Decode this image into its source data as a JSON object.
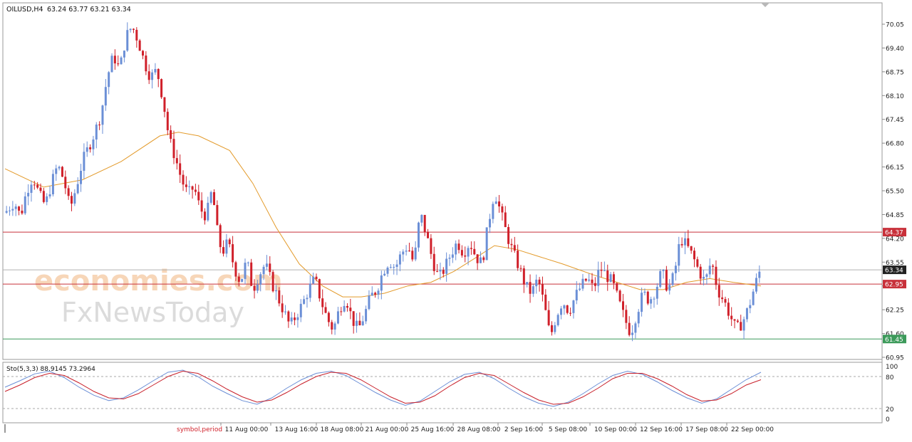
{
  "header": {
    "symbol": "OILUSD,H4",
    "ohlc": "63.24 63.77 63.21 63.34"
  },
  "watermark": {
    "line1": "economies.com",
    "line2": "FxNewsToday"
  },
  "price_axis": {
    "ticks": [
      "70.05",
      "69.40",
      "68.75",
      "68.10",
      "67.45",
      "66.80",
      "66.15",
      "65.50",
      "64.85",
      "64.20",
      "63.55",
      "62.90",
      "62.25",
      "61.60",
      "60.95"
    ]
  },
  "oscillator": {
    "label": "Sto(5,3,3) 88.9145 73.2964",
    "ticks": [
      "100",
      "80",
      "20",
      "0"
    ]
  },
  "time_axis": {
    "ticks": [
      "11 Aug 00:00",
      "13 Aug 16:00",
      "18 Aug 08:00",
      "21 Aug 00:00",
      "25 Aug 16:00",
      "28 Aug 08:00",
      "2 Sep 16:00",
      "5 Sep 08:00",
      "10 Sep 00:00",
      "12 Sep 16:00",
      "17 Sep 08:00",
      "22 Sep 00:00"
    ],
    "note": "symbol,period"
  },
  "colors": {
    "bull": "#6b8fd6",
    "bear": "#d0202a",
    "ma": "#e39a2a",
    "sto_main": "#6b8fd6",
    "sto_signal": "#c8202a",
    "red_line": "#c8303a",
    "green_line": "#3c9a5a",
    "current_line": "#b0b0b0"
  },
  "chart_data": {
    "type": "candlestick",
    "title": "OILUSD,H4",
    "ylim": [
      60.65,
      70.5
    ],
    "levels": [
      {
        "label": "64.37",
        "value": 64.37,
        "color": "#c8303a"
      },
      {
        "label": "63.34",
        "value": 63.34,
        "color": "#222222",
        "current": true
      },
      {
        "label": "62.95",
        "value": 62.95,
        "color": "#c8303a"
      },
      {
        "label": "61.45",
        "value": 61.45,
        "color": "#3c9a5a"
      }
    ],
    "close_path": [
      [
        0,
        64.9
      ],
      [
        6,
        65.2
      ],
      [
        10,
        64.8
      ],
      [
        14,
        65.5
      ],
      [
        18,
        65.9
      ],
      [
        22,
        65.4
      ],
      [
        26,
        65.1
      ],
      [
        30,
        65.7
      ],
      [
        34,
        66.2
      ],
      [
        38,
        65.8
      ],
      [
        42,
        65.0
      ],
      [
        46,
        65.6
      ],
      [
        50,
        66.3
      ],
      [
        54,
        66.7
      ],
      [
        58,
        67.1
      ],
      [
        62,
        67.6
      ],
      [
        66,
        68.6
      ],
      [
        70,
        69.2
      ],
      [
        74,
        68.8
      ],
      [
        78,
        69.7
      ],
      [
        82,
        70.0
      ],
      [
        86,
        69.6
      ],
      [
        90,
        69.0
      ],
      [
        94,
        68.6
      ],
      [
        98,
        68.8
      ],
      [
        102,
        68.0
      ],
      [
        106,
        66.9
      ],
      [
        110,
        66.4
      ],
      [
        114,
        65.8
      ],
      [
        118,
        65.4
      ],
      [
        122,
        65.6
      ],
      [
        126,
        65.0
      ],
      [
        130,
        64.8
      ],
      [
        134,
        65.6
      ],
      [
        136,
        64.6
      ],
      [
        140,
        63.8
      ],
      [
        144,
        64.1
      ],
      [
        148,
        63.4
      ],
      [
        152,
        63.0
      ],
      [
        156,
        63.6
      ],
      [
        160,
        62.8
      ],
      [
        164,
        63.2
      ],
      [
        168,
        63.5
      ],
      [
        172,
        63.0
      ],
      [
        176,
        62.6
      ],
      [
        180,
        62.2
      ],
      [
        184,
        61.8
      ],
      [
        188,
        62.1
      ],
      [
        192,
        62.4
      ],
      [
        196,
        62.8
      ],
      [
        200,
        63.1
      ],
      [
        204,
        62.5
      ],
      [
        208,
        62.0
      ],
      [
        212,
        61.7
      ],
      [
        216,
        62.3
      ],
      [
        220,
        62.6
      ],
      [
        224,
        62.0
      ],
      [
        228,
        61.7
      ],
      [
        232,
        62.1
      ],
      [
        236,
        62.6
      ],
      [
        240,
        62.8
      ],
      [
        244,
        63.3
      ],
      [
        248,
        63.6
      ],
      [
        252,
        63.4
      ],
      [
        256,
        63.8
      ],
      [
        260,
        64.0
      ],
      [
        264,
        63.5
      ],
      [
        268,
        64.9
      ],
      [
        272,
        64.3
      ],
      [
        276,
        63.6
      ],
      [
        280,
        63.1
      ],
      [
        284,
        63.4
      ],
      [
        288,
        63.8
      ],
      [
        292,
        64.1
      ],
      [
        296,
        63.8
      ],
      [
        300,
        64.1
      ],
      [
        304,
        63.7
      ],
      [
        308,
        63.5
      ],
      [
        312,
        64.6
      ],
      [
        316,
        65.5
      ],
      [
        320,
        64.9
      ],
      [
        324,
        64.3
      ],
      [
        328,
        63.8
      ],
      [
        332,
        63.4
      ],
      [
        336,
        62.9
      ],
      [
        340,
        62.7
      ],
      [
        344,
        63.1
      ],
      [
        348,
        62.4
      ],
      [
        352,
        61.5
      ],
      [
        356,
        62.1
      ],
      [
        360,
        62.5
      ],
      [
        364,
        62.2
      ],
      [
        368,
        62.6
      ],
      [
        372,
        62.9
      ],
      [
        376,
        63.1
      ],
      [
        380,
        62.8
      ],
      [
        384,
        63.4
      ],
      [
        388,
        63.2
      ],
      [
        392,
        63.0
      ],
      [
        396,
        62.5
      ],
      [
        400,
        62.0
      ],
      [
        404,
        61.6
      ],
      [
        408,
        62.2
      ],
      [
        412,
        62.7
      ],
      [
        416,
        62.5
      ],
      [
        420,
        62.8
      ],
      [
        424,
        63.3
      ],
      [
        428,
        62.8
      ],
      [
        432,
        63.2
      ],
      [
        436,
        64.2
      ],
      [
        440,
        64.0
      ],
      [
        444,
        63.7
      ],
      [
        448,
        63.3
      ],
      [
        452,
        63.0
      ],
      [
        456,
        63.6
      ],
      [
        460,
        62.8
      ],
      [
        464,
        62.5
      ],
      [
        468,
        62.1
      ],
      [
        472,
        61.7
      ],
      [
        476,
        61.9
      ],
      [
        480,
        62.3
      ],
      [
        484,
        62.9
      ],
      [
        488,
        63.4
      ]
    ],
    "ma_path": [
      [
        0,
        66.1
      ],
      [
        25,
        65.6
      ],
      [
        50,
        65.8
      ],
      [
        75,
        66.3
      ],
      [
        100,
        67.0
      ],
      [
        112,
        67.1
      ],
      [
        125,
        67.0
      ],
      [
        145,
        66.6
      ],
      [
        160,
        65.7
      ],
      [
        175,
        64.5
      ],
      [
        190,
        63.5
      ],
      [
        205,
        62.9
      ],
      [
        218,
        62.6
      ],
      [
        230,
        62.6
      ],
      [
        245,
        62.7
      ],
      [
        260,
        62.9
      ],
      [
        275,
        63.0
      ],
      [
        290,
        63.3
      ],
      [
        305,
        63.7
      ],
      [
        316,
        64.0
      ],
      [
        330,
        63.9
      ],
      [
        345,
        63.7
      ],
      [
        360,
        63.5
      ],
      [
        380,
        63.2
      ],
      [
        395,
        63.0
      ],
      [
        410,
        62.8
      ],
      [
        425,
        62.8
      ],
      [
        440,
        63.0
      ],
      [
        455,
        63.1
      ],
      [
        470,
        63.0
      ],
      [
        488,
        62.9
      ]
    ],
    "sto_main": [
      60,
      72,
      85,
      90,
      78,
      60,
      45,
      35,
      40,
      55,
      72,
      88,
      92,
      80,
      62,
      48,
      35,
      28,
      40,
      58,
      74,
      86,
      90,
      82,
      66,
      50,
      36,
      26,
      34,
      52,
      70,
      84,
      88,
      76,
      58,
      42,
      30,
      24,
      32,
      48,
      66,
      82,
      90,
      84,
      70,
      54,
      40,
      30,
      38,
      56,
      74,
      88
    ],
    "sto_signal": [
      52,
      64,
      78,
      86,
      82,
      68,
      52,
      40,
      38,
      48,
      64,
      80,
      90,
      86,
      72,
      56,
      42,
      32,
      36,
      50,
      66,
      80,
      88,
      86,
      74,
      58,
      42,
      30,
      32,
      44,
      62,
      78,
      86,
      82,
      66,
      50,
      36,
      28,
      30,
      42,
      58,
      76,
      86,
      86,
      76,
      62,
      46,
      34,
      36,
      48,
      64,
      74
    ]
  }
}
